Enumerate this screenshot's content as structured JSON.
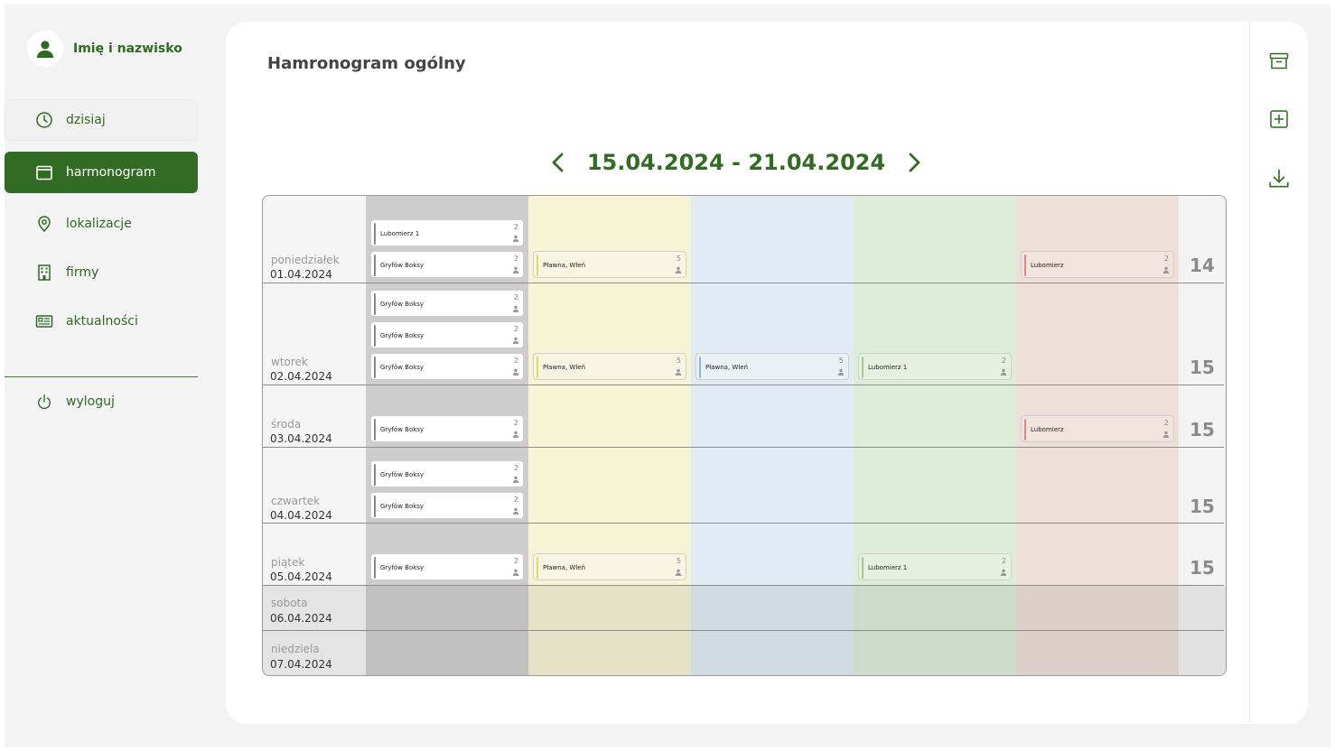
{
  "user": {
    "name": "Imię i nazwisko"
  },
  "nav": {
    "items": [
      {
        "label": "dzisiaj",
        "icon": "clock-icon"
      },
      {
        "label": "harmonogram",
        "icon": "calendar-icon"
      },
      {
        "label": "lokalizacje",
        "icon": "location-pin-icon"
      },
      {
        "label": "firmy",
        "icon": "building-icon"
      },
      {
        "label": "aktualności",
        "icon": "news-icon"
      }
    ],
    "logout": {
      "label": "wyloguj",
      "icon": "power-icon"
    }
  },
  "page": {
    "title": "Hamronogram ogólny"
  },
  "week": {
    "range": "15.04.2024 - 21.04.2024"
  },
  "toolbar": [
    {
      "icon": "archive-icon"
    },
    {
      "icon": "add-box-icon"
    },
    {
      "icon": "download-icon"
    }
  ],
  "colors": {
    "brand": "#316b24",
    "columns": [
      "#cdcdcd",
      "#f7f3d5",
      "#e2ebf3",
      "#ddedd8",
      "#ede0d8"
    ]
  },
  "schedule": {
    "days": [
      {
        "name": "poniedziałek",
        "date": "01.04.2024",
        "count": "14"
      },
      {
        "name": "wtorek",
        "date": "02.04.2024",
        "count": "15"
      },
      {
        "name": "środa",
        "date": "03.04.2024",
        "count": "15"
      },
      {
        "name": "czwartek",
        "date": "04.04.2024",
        "count": "15"
      },
      {
        "name": "piątek",
        "date": "05.04.2024",
        "count": "15"
      },
      {
        "name": "sobota",
        "date": "06.04.2024",
        "count": ""
      },
      {
        "name": "niedziela",
        "date": "07.04.2024",
        "count": ""
      }
    ],
    "shifts": [
      {
        "day": 0,
        "column": 0,
        "label": "Lubomierz 1",
        "people": "2"
      },
      {
        "day": 0,
        "column": 0,
        "label": "Gryfów Boksy",
        "people": "2"
      },
      {
        "day": 0,
        "column": 1,
        "label": "Pławna, Wleń",
        "people": "5"
      },
      {
        "day": 0,
        "column": 4,
        "label": "Lubomierz",
        "people": "2"
      },
      {
        "day": 1,
        "column": 0,
        "label": "Gryfów Boksy",
        "people": "2"
      },
      {
        "day": 1,
        "column": 0,
        "label": "Gryfów Boksy",
        "people": "2"
      },
      {
        "day": 1,
        "column": 0,
        "label": "Gryfów Boksy",
        "people": "2"
      },
      {
        "day": 1,
        "column": 1,
        "label": "Pławna, Wleń",
        "people": "5"
      },
      {
        "day": 1,
        "column": 2,
        "label": "Pławna, Wleń",
        "people": "5"
      },
      {
        "day": 1,
        "column": 3,
        "label": "Lubomierz 1",
        "people": "2"
      },
      {
        "day": 2,
        "column": 0,
        "label": "Gryfów Boksy",
        "people": "2"
      },
      {
        "day": 2,
        "column": 4,
        "label": "Lubomierz",
        "people": "2"
      },
      {
        "day": 3,
        "column": 0,
        "label": "Gryfów Boksy",
        "people": "2"
      },
      {
        "day": 3,
        "column": 0,
        "label": "Gryfów Boksy",
        "people": "2"
      },
      {
        "day": 4,
        "column": 0,
        "label": "Gryfów Boksy",
        "people": "2"
      },
      {
        "day": 4,
        "column": 1,
        "label": "Pławna, Wleń",
        "people": "5"
      },
      {
        "day": 4,
        "column": 3,
        "label": "Lubomierz 1",
        "people": "2"
      }
    ]
  }
}
